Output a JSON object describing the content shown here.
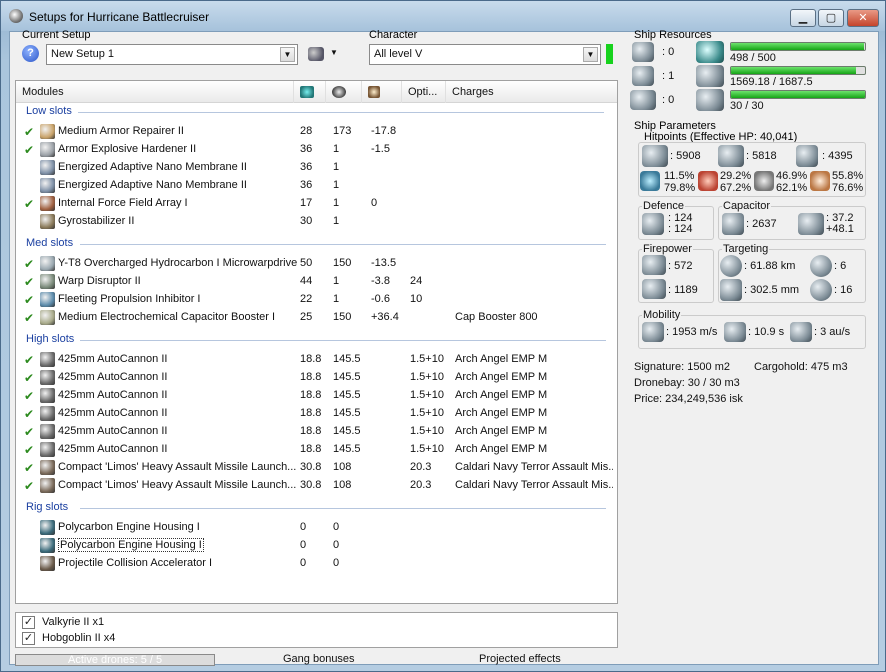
{
  "window": {
    "title": "Setups for Hurricane Battlecruiser"
  },
  "setup": {
    "current_label": "Current Setup",
    "current_value": "New Setup 1",
    "character_label": "Character",
    "character_value": "All level V"
  },
  "modules_table": {
    "columns": [
      "Modules",
      "",
      "",
      "",
      "Opti...",
      "Charges"
    ],
    "sections": [
      {
        "title": "Low slots",
        "rows": [
          {
            "checked": true,
            "name": "Medium Armor Repairer II",
            "c1": "28",
            "c2": "173",
            "c3": "-17.8",
            "opt": "",
            "charge": "",
            "icon": "armor-repairer-icon"
          },
          {
            "checked": true,
            "name": "Armor Explosive Hardener II",
            "c1": "36",
            "c2": "1",
            "c3": "-1.5",
            "opt": "",
            "charge": "",
            "icon": "armor-hardener-icon"
          },
          {
            "checked": false,
            "name": "Energized Adaptive Nano Membrane II",
            "c1": "36",
            "c2": "1",
            "c3": "",
            "opt": "",
            "charge": "",
            "icon": "nano-membrane-icon"
          },
          {
            "checked": false,
            "name": "Energized Adaptive Nano Membrane II",
            "c1": "36",
            "c2": "1",
            "c3": "",
            "opt": "",
            "charge": "",
            "icon": "nano-membrane-icon"
          },
          {
            "checked": true,
            "name": "Internal Force Field Array I",
            "c1": "17",
            "c2": "1",
            "c3": "0",
            "opt": "",
            "charge": "",
            "icon": "force-field-icon"
          },
          {
            "checked": false,
            "name": "Gyrostabilizer II",
            "c1": "30",
            "c2": "1",
            "c3": "",
            "opt": "",
            "charge": "",
            "icon": "gyrostabilizer-icon"
          }
        ]
      },
      {
        "title": "Med slots",
        "rows": [
          {
            "checked": true,
            "name": "Y-T8 Overcharged Hydrocarbon I Microwarpdrive",
            "c1": "50",
            "c2": "150",
            "c3": "-13.5",
            "opt": "",
            "charge": "",
            "icon": "microwarpdrive-icon"
          },
          {
            "checked": true,
            "name": "Warp Disruptor II",
            "c1": "44",
            "c2": "1",
            "c3": "-3.8",
            "opt": "24",
            "charge": "",
            "icon": "warp-disruptor-icon"
          },
          {
            "checked": true,
            "name": "Fleeting Propulsion Inhibitor I",
            "c1": "22",
            "c2": "1",
            "c3": "-0.6",
            "opt": "10",
            "charge": "",
            "icon": "propulsion-inhibitor-icon"
          },
          {
            "checked": true,
            "name": "Medium Electrochemical Capacitor Booster I",
            "c1": "25",
            "c2": "150",
            "c3": "+36.4",
            "opt": "",
            "charge": "Cap Booster 800",
            "icon": "capacitor-booster-icon"
          }
        ]
      },
      {
        "title": "High slots",
        "rows": [
          {
            "checked": true,
            "name": "425mm AutoCannon II",
            "c1": "18.8",
            "c2": "145.5",
            "c3": "",
            "opt": "1.5+10",
            "charge": "Arch Angel EMP M",
            "icon": "autocannon-icon"
          },
          {
            "checked": true,
            "name": "425mm AutoCannon II",
            "c1": "18.8",
            "c2": "145.5",
            "c3": "",
            "opt": "1.5+10",
            "charge": "Arch Angel EMP M",
            "icon": "autocannon-icon"
          },
          {
            "checked": true,
            "name": "425mm AutoCannon II",
            "c1": "18.8",
            "c2": "145.5",
            "c3": "",
            "opt": "1.5+10",
            "charge": "Arch Angel EMP M",
            "icon": "autocannon-icon"
          },
          {
            "checked": true,
            "name": "425mm AutoCannon II",
            "c1": "18.8",
            "c2": "145.5",
            "c3": "",
            "opt": "1.5+10",
            "charge": "Arch Angel EMP M",
            "icon": "autocannon-icon"
          },
          {
            "checked": true,
            "name": "425mm AutoCannon II",
            "c1": "18.8",
            "c2": "145.5",
            "c3": "",
            "opt": "1.5+10",
            "charge": "Arch Angel EMP M",
            "icon": "autocannon-icon"
          },
          {
            "checked": true,
            "name": "425mm AutoCannon II",
            "c1": "18.8",
            "c2": "145.5",
            "c3": "",
            "opt": "1.5+10",
            "charge": "Arch Angel EMP M",
            "icon": "autocannon-icon"
          },
          {
            "checked": true,
            "name": "Compact 'Limos' Heavy Assault Missile Launch...",
            "c1": "30.8",
            "c2": "108",
            "c3": "",
            "opt": "20.3",
            "charge": "Caldari Navy Terror Assault Mis...",
            "icon": "missile-launcher-icon"
          },
          {
            "checked": true,
            "name": "Compact 'Limos' Heavy Assault Missile Launch...",
            "c1": "30.8",
            "c2": "108",
            "c3": "",
            "opt": "20.3",
            "charge": "Caldari Navy Terror Assault Mis...",
            "icon": "missile-launcher-icon"
          }
        ]
      },
      {
        "title": "Rig slots",
        "rows": [
          {
            "checked": false,
            "name": "Polycarbon Engine Housing I",
            "c1": "0",
            "c2": "0",
            "c3": "",
            "opt": "",
            "charge": "",
            "icon": "engine-rig-icon"
          },
          {
            "checked": false,
            "name": "Polycarbon Engine Housing I",
            "c1": "0",
            "c2": "0",
            "c3": "",
            "opt": "",
            "charge": "",
            "icon": "engine-rig-icon",
            "selected": true
          },
          {
            "checked": false,
            "name": "Projectile Collision Accelerator I",
            "c1": "0",
            "c2": "0",
            "c3": "",
            "opt": "",
            "charge": "",
            "icon": "projectile-rig-icon"
          }
        ]
      }
    ]
  },
  "drones": [
    {
      "label": "Valkyrie II x1",
      "checked": true
    },
    {
      "label": "Hobgoblin II x4",
      "checked": true
    }
  ],
  "status_bar": {
    "active_drones": "Active drones: 5 / 5",
    "gang_bonuses": "Gang bonuses",
    "projected_effects": "Projected effects"
  },
  "resources": {
    "title": "Ship Resources",
    "turret_count": ": 0",
    "launcher_count": ": 1",
    "calibration_count": ": 0",
    "cpu_value": "498 / 500",
    "cpu_fraction": 0.996,
    "powergrid_value": "1569.18 / 1687.5",
    "powergrid_fraction": 0.93,
    "drone_bw_value": "30 / 30",
    "drone_bw_fraction": 1.0
  },
  "parameters": {
    "title": "Ship Parameters",
    "hitpoints_title": "Hitpoints (Effective HP: 40,041)",
    "shield_hp": ": 5908",
    "armor_hp": ": 5818",
    "structure_hp": ": 4395",
    "em_shield": "11.5%",
    "em_armor": "79.8%",
    "thermal_shield": "29.2%",
    "thermal_armor": "67.2%",
    "kinetic_shield": "46.9%",
    "kinetic_armor": "62.1%",
    "explosive_shield": "55.8%",
    "explosive_armor": "76.6%",
    "defence_title": "Defence",
    "defence_top": ": 124",
    "defence_bottom": ": 124",
    "capacitor_title": "Capacitor",
    "capacitor_value": ": 2637",
    "cap_rate_top": ": 37.2",
    "cap_rate_bottom": "+48.1",
    "firepower_title": "Firepower",
    "firepower_top": ": 572",
    "firepower_bottom": ": 1189",
    "targeting_title": "Targeting",
    "target_range": ": 61.88 km",
    "max_targets": ": 6",
    "scan_res": ": 302.5 mm",
    "sensor_strength": ": 16",
    "mobility_title": "Mobility",
    "velocity": ": 1953 m/s",
    "align_time": ": 10.9 s",
    "warp_speed": ": 3 au/s"
  },
  "summary": {
    "signature": "Signature: 1500 m2",
    "cargohold": "Cargohold: 475 m3",
    "dronebay": "Dronebay: 30 / 30 m3",
    "price": "Price: 234,249,536 isk"
  },
  "colors": {
    "accent": "#1a3fa0",
    "check": "#2c8a1e",
    "bar_fill": "#16a516"
  }
}
